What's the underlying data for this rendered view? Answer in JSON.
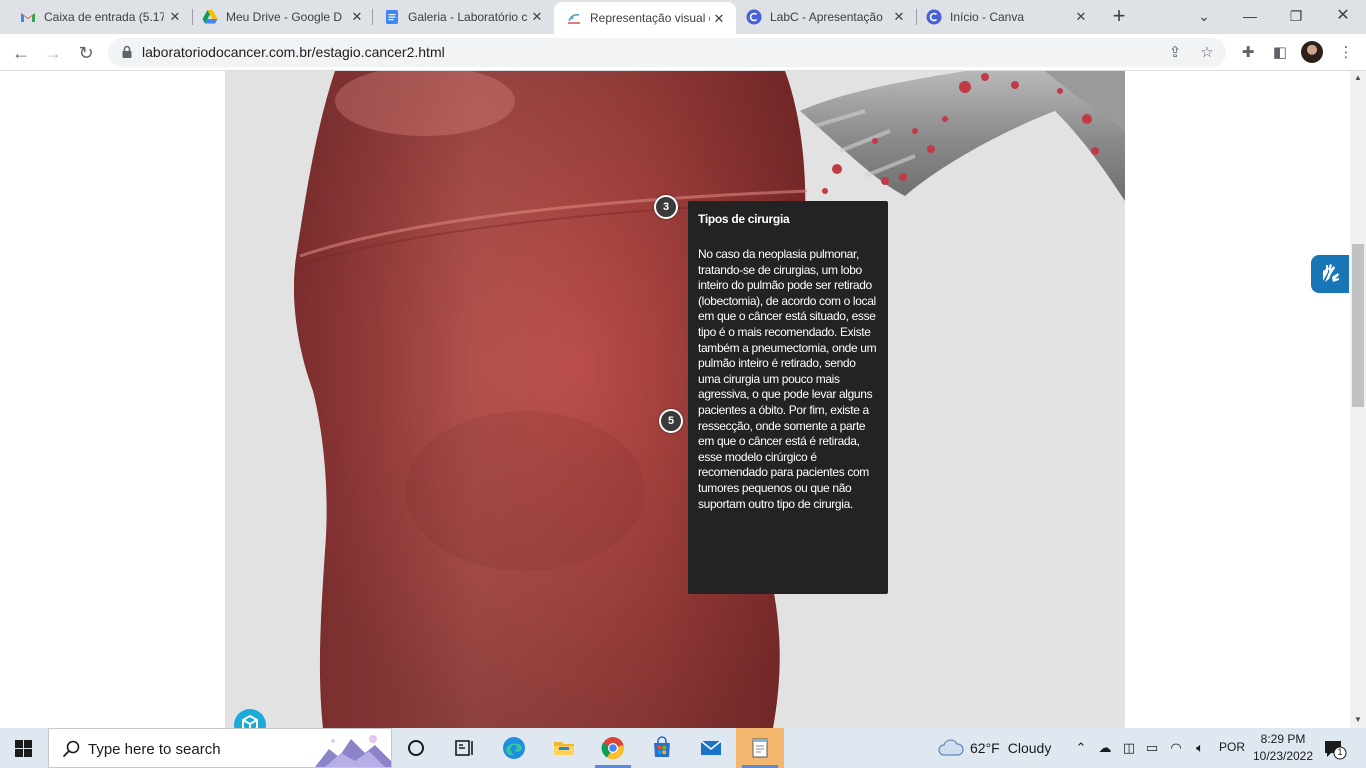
{
  "browser": {
    "tabs": [
      {
        "title": "Caixa de entrada (5.17",
        "icon": "gmail-icon",
        "active": false
      },
      {
        "title": "Meu Drive - Google D",
        "icon": "google-drive-icon",
        "active": false
      },
      {
        "title": "Galeria - Laboratório c",
        "icon": "google-docs-icon",
        "active": false
      },
      {
        "title": "Representação visual d",
        "icon": "labc-page-icon",
        "active": true
      },
      {
        "title": "LabC - Apresentação",
        "icon": "canva-icon",
        "active": false
      },
      {
        "title": "Início - Canva",
        "icon": "canva-icon",
        "active": false
      }
    ],
    "address": {
      "url": "laboratoriodocancer.com.br/estagio.cancer2.html"
    }
  },
  "page": {
    "hotspots": [
      {
        "label": "3"
      },
      {
        "label": "5"
      }
    ],
    "tooltip": {
      "title": "Tipos de cirurgia",
      "body": "No caso da neoplasia pulmonar, tratando-se de cirurgias, um lobo inteiro do pulmão pode ser retirado (lobectomia), de acordo com o local em que o câncer está situado, esse tipo é o mais recomendado. Existe também a pneumectomia, onde um pulmão inteiro é retirado, sendo uma cirurgia um pouco mais agressiva, o que pode levar alguns pacientes a óbito. Por fim, existe a ressecção, onde somente a parte em que o câncer está é retirada, esse modelo cirúrgico é recomendado para pacientes com tumores pequenos ou que não suportam outro tipo de cirurgia."
    },
    "colors": {
      "lung": "#b84a48",
      "stage_background": "#e2e2e2",
      "tooltip_background": "#232323",
      "vlibras": "#1976b6"
    }
  },
  "taskbar": {
    "search_placeholder": "Type here to search",
    "weather": {
      "temp": "62°F",
      "condition": "Cloudy"
    },
    "language": "POR",
    "time": "8:29 PM",
    "date": "10/23/2022",
    "notification_count": "1",
    "apps": [
      "task-view-icon",
      "widgets-icon",
      "edge-icon",
      "file-explorer-icon",
      "chrome-icon",
      "microsoft-store-icon",
      "mail-icon",
      "notepad-icon"
    ]
  }
}
